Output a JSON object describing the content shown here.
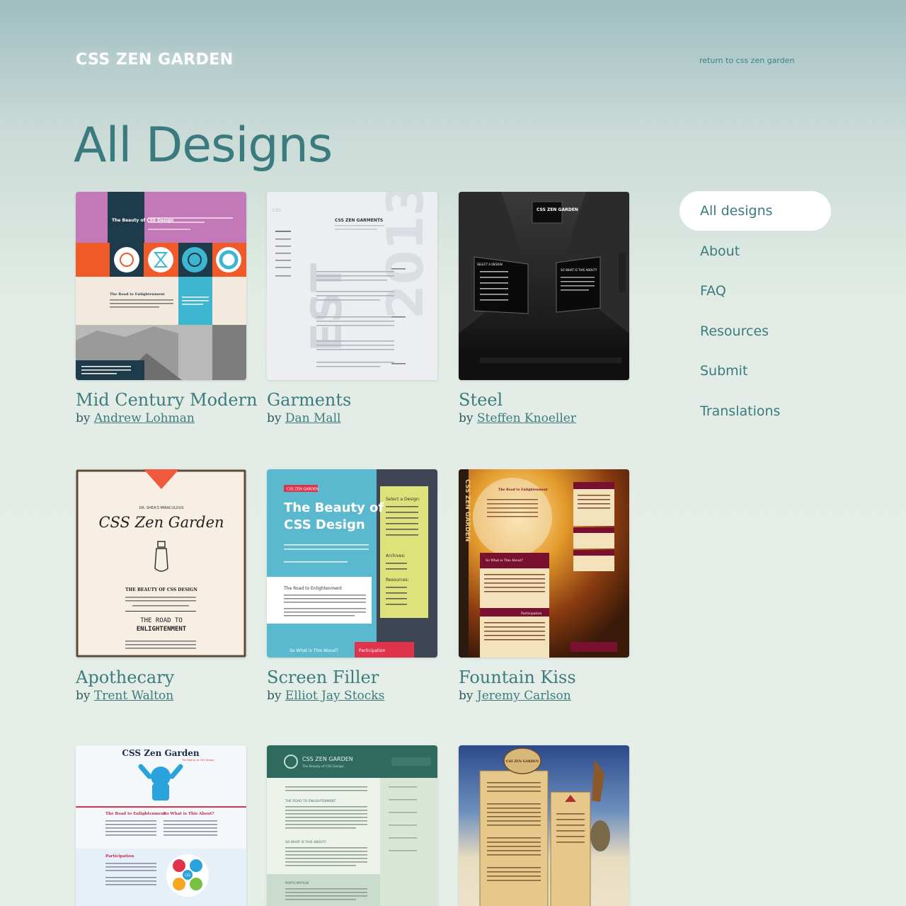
{
  "header": {
    "logo": "CSS ZEN GARDEN",
    "return_link": "return to css zen garden"
  },
  "page_title": "All Designs",
  "nav": {
    "items": [
      {
        "label": "All designs",
        "active": true
      },
      {
        "label": "About"
      },
      {
        "label": "FAQ"
      },
      {
        "label": "Resources"
      },
      {
        "label": "Submit"
      },
      {
        "label": "Translations"
      }
    ]
  },
  "designs": [
    {
      "title": "Mid Century Modern",
      "by": "by",
      "author": "Andrew Lohman"
    },
    {
      "title": "Garments",
      "by": "by",
      "author": "Dan Mall"
    },
    {
      "title": "Steel",
      "by": "by",
      "author": "Steffen Knoeller"
    },
    {
      "title": "Apothecary",
      "by": "by",
      "author": "Trent Walton"
    },
    {
      "title": "Screen Filler",
      "by": "by",
      "author": "Elliot Jay Stocks"
    },
    {
      "title": "Fountain Kiss",
      "by": "by",
      "author": "Jeremy Carlson"
    },
    {
      "title": "",
      "by": "",
      "author": ""
    },
    {
      "title": "",
      "by": "",
      "author": ""
    },
    {
      "title": "",
      "by": "",
      "author": ""
    }
  ],
  "thumb_text": {
    "mcm_heading": "The Beauty of CSS Design",
    "mcm_road": "The Road to Enlightenment",
    "garments_heading": "CSS ZEN GARMENTS",
    "garments_logo": "CSS",
    "steel_heading": "CSS ZEN GARDEN",
    "steel_select": "SELECT A DESIGN",
    "steel_about": "SO WHAT IS THIS ABOUT?",
    "apoth_small": "DR. SHEA'S MIRACULOUS",
    "apoth_title": "CSS Zen Garden",
    "apoth_beauty": "THE BEAUTY OF CSS DESIGN",
    "apoth_road1": "THE ROAD TO",
    "apoth_road2": "ENLIGHTENMENT",
    "filler_tag": "CSS ZEN GARDEN",
    "filler_h1": "The Beauty of",
    "filler_h2": "CSS Design",
    "filler_select": "Select a Design:",
    "filler_archives": "Archives:",
    "filler_resources": "Resources:",
    "filler_road": "The Road to Enlightenment",
    "filler_about": "So What is This About?",
    "filler_part": "Participation",
    "fk_side": "CSS ZEN GARDEN",
    "fk_road": "The Road to Enlightenment",
    "fk_about": "So What is This About?",
    "fk_part": "Participation",
    "zen2_title": "CSS Zen Garden",
    "zen2_sub": "The Beauty of CSS Design",
    "zen2_road": "The Road to Enlightenment",
    "zen2_about": "So What is This About?",
    "zen2_part": "Participation",
    "zen2_badge": "CSS",
    "green_title": "CSS ZEN GARDEN",
    "green_sub": "The Beauty of CSS Design",
    "green_road": "THE ROAD TO ENLIGHTENMENT",
    "green_about": "SO WHAT IS THIS ABOUT?",
    "green_part": "PARTICIPATION",
    "parch_badge": "CSS ZEN GARDEN"
  },
  "colors": {
    "accent": "#3d7b7e",
    "nav_active_bg": "#ffffff",
    "logo": "#ffffff"
  }
}
